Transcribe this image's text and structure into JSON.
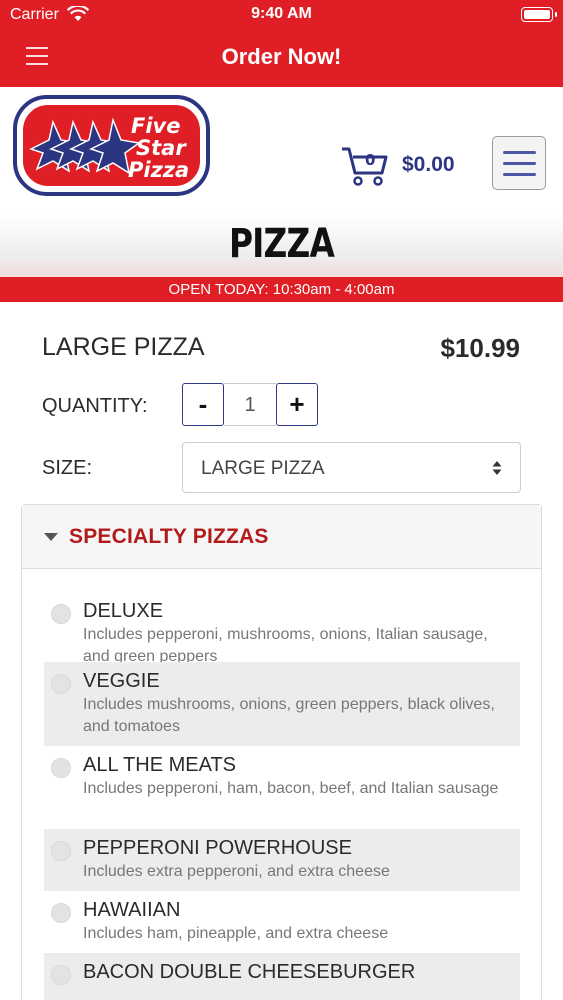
{
  "status_bar": {
    "carrier": "Carrier",
    "time": "9:40 AM"
  },
  "app_bar": {
    "title": "Order Now!"
  },
  "brand": {
    "logo_text": [
      "Five",
      "Star",
      "Pizza"
    ],
    "cart_count": "0",
    "cart_total": "$0.00"
  },
  "page": {
    "title": "PIZZA",
    "hours": "OPEN TODAY: 10:30am - 4:00am"
  },
  "product": {
    "name": "LARGE PIZZA",
    "price": "$10.99",
    "quantity_label": "QUANTITY:",
    "quantity_value": "1",
    "minus_label": "-",
    "plus_label": "+",
    "size_label": "SIZE:",
    "size_value": "LARGE PIZZA"
  },
  "specialty": {
    "title": "SPECIALTY PIZZAS",
    "options": [
      {
        "name": "DELUXE",
        "desc": "Includes pepperoni, mushrooms, onions, Italian sausage, and green peppers"
      },
      {
        "name": "VEGGIE",
        "desc": "Includes mushrooms, onions, green peppers, black olives, and tomatoes"
      },
      {
        "name": "ALL THE MEATS",
        "desc": "Includes pepperoni, ham, bacon, beef, and Italian sausage"
      },
      {
        "name": "PEPPERONI POWERHOUSE",
        "desc": "Includes extra pepperoni, and extra cheese"
      },
      {
        "name": "HAWAIIAN",
        "desc": "Includes ham, pineapple, and extra cheese"
      },
      {
        "name": "BACON DOUBLE CHEESEBURGER",
        "desc": ""
      }
    ]
  },
  "colors": {
    "brand_red": "#e01e26",
    "brand_navy": "#2c3581",
    "section_red": "#b31b1b"
  }
}
